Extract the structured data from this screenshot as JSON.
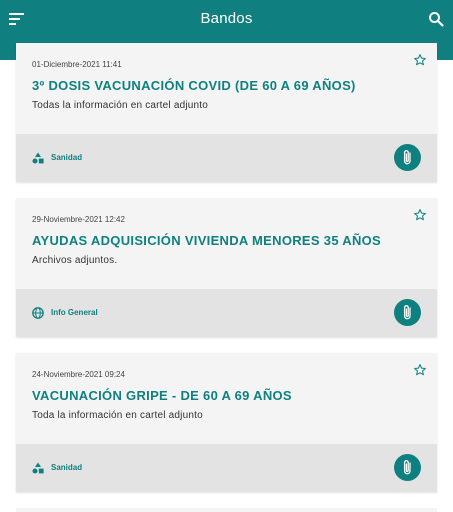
{
  "appbar": {
    "title": "Bandos",
    "menu_icon": "menu-icon",
    "search_icon": "search-icon",
    "color": "#0f7f7f"
  },
  "items": [
    {
      "date": "01-Diciembre-2021 11:41",
      "title": "3º DOSIS VACUNACIÓN COVID (DE 60 A 69 AÑOS)",
      "description": "Todas la información en cartel adjunto",
      "category": "Sanidad",
      "category_icon": "shapes-icon"
    },
    {
      "date": "29-Noviembre-2021 12:42",
      "title": "AYUDAS ADQUISICIÓN VIVIENDA MENORES 35 AÑOS",
      "description": "Archivos adjuntos.",
      "category": "Info General",
      "category_icon": "globe-icon"
    },
    {
      "date": "24-Noviembre-2021 09:24",
      "title": "VACUNACIÓN GRIPE - DE 60 A 69 AÑOS",
      "description": "Toda la información en cartel adjunto",
      "category": "Sanidad",
      "category_icon": "shapes-icon"
    }
  ]
}
